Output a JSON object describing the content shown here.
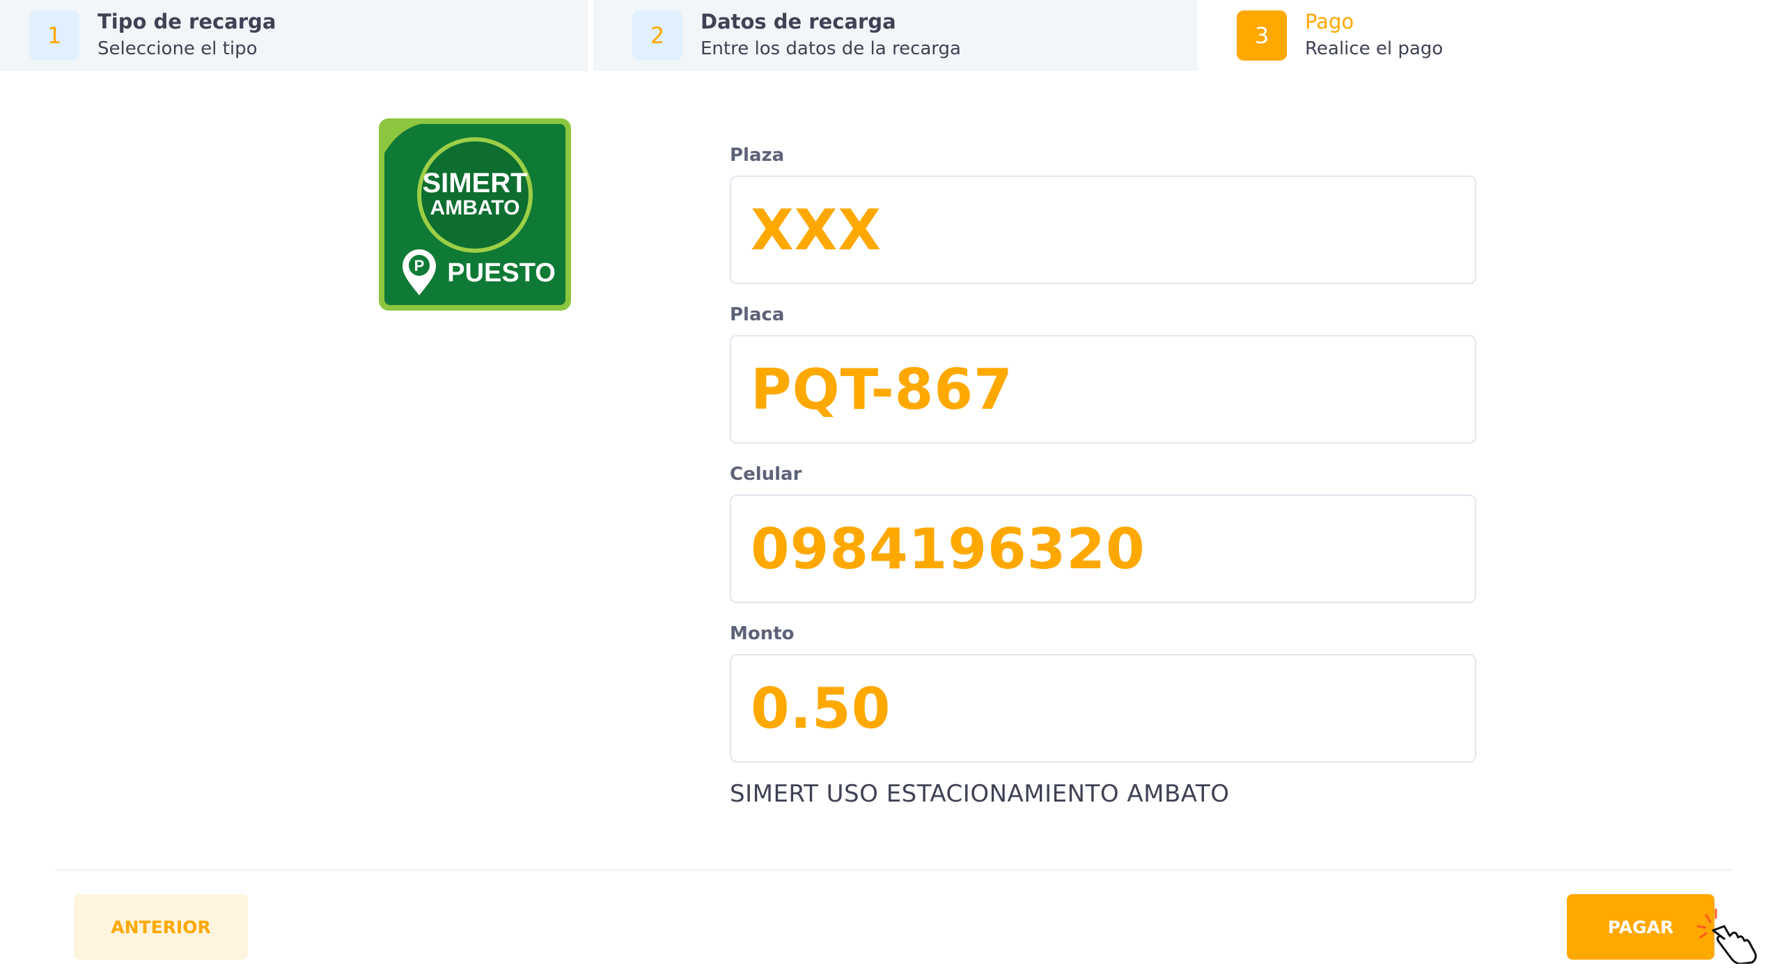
{
  "stepper": {
    "steps": [
      {
        "number": "1",
        "title": "Tipo de recarga",
        "subtitle": "Seleccione el tipo"
      },
      {
        "number": "2",
        "title": "Datos de recarga",
        "subtitle": "Entre los datos de la recarga"
      },
      {
        "number": "3",
        "title": "Pago",
        "subtitle": "Realice el pago"
      }
    ],
    "active_step": 3
  },
  "logo": {
    "text_top": "SIMERT",
    "text_mid": "AMBATO",
    "text_bottom": "PUESTO"
  },
  "form": {
    "fields": [
      {
        "label": "Plaza",
        "value": "XXX"
      },
      {
        "label": "Placa",
        "value": "PQT-867"
      },
      {
        "label": "Celular",
        "value": "0984196320"
      },
      {
        "label": "Monto",
        "value": "0.50"
      }
    ],
    "description": "SIMERT USO ESTACIONAMIENTO AMBATO"
  },
  "actions": {
    "previous_label": "ANTERIOR",
    "pay_label": "PAGAR"
  },
  "colors": {
    "accent": "#ffa800",
    "accent_light": "#fff4de",
    "step_bg": "#f3f6f9",
    "logo_green": "#0f7a35",
    "logo_border": "#8dc63f"
  }
}
